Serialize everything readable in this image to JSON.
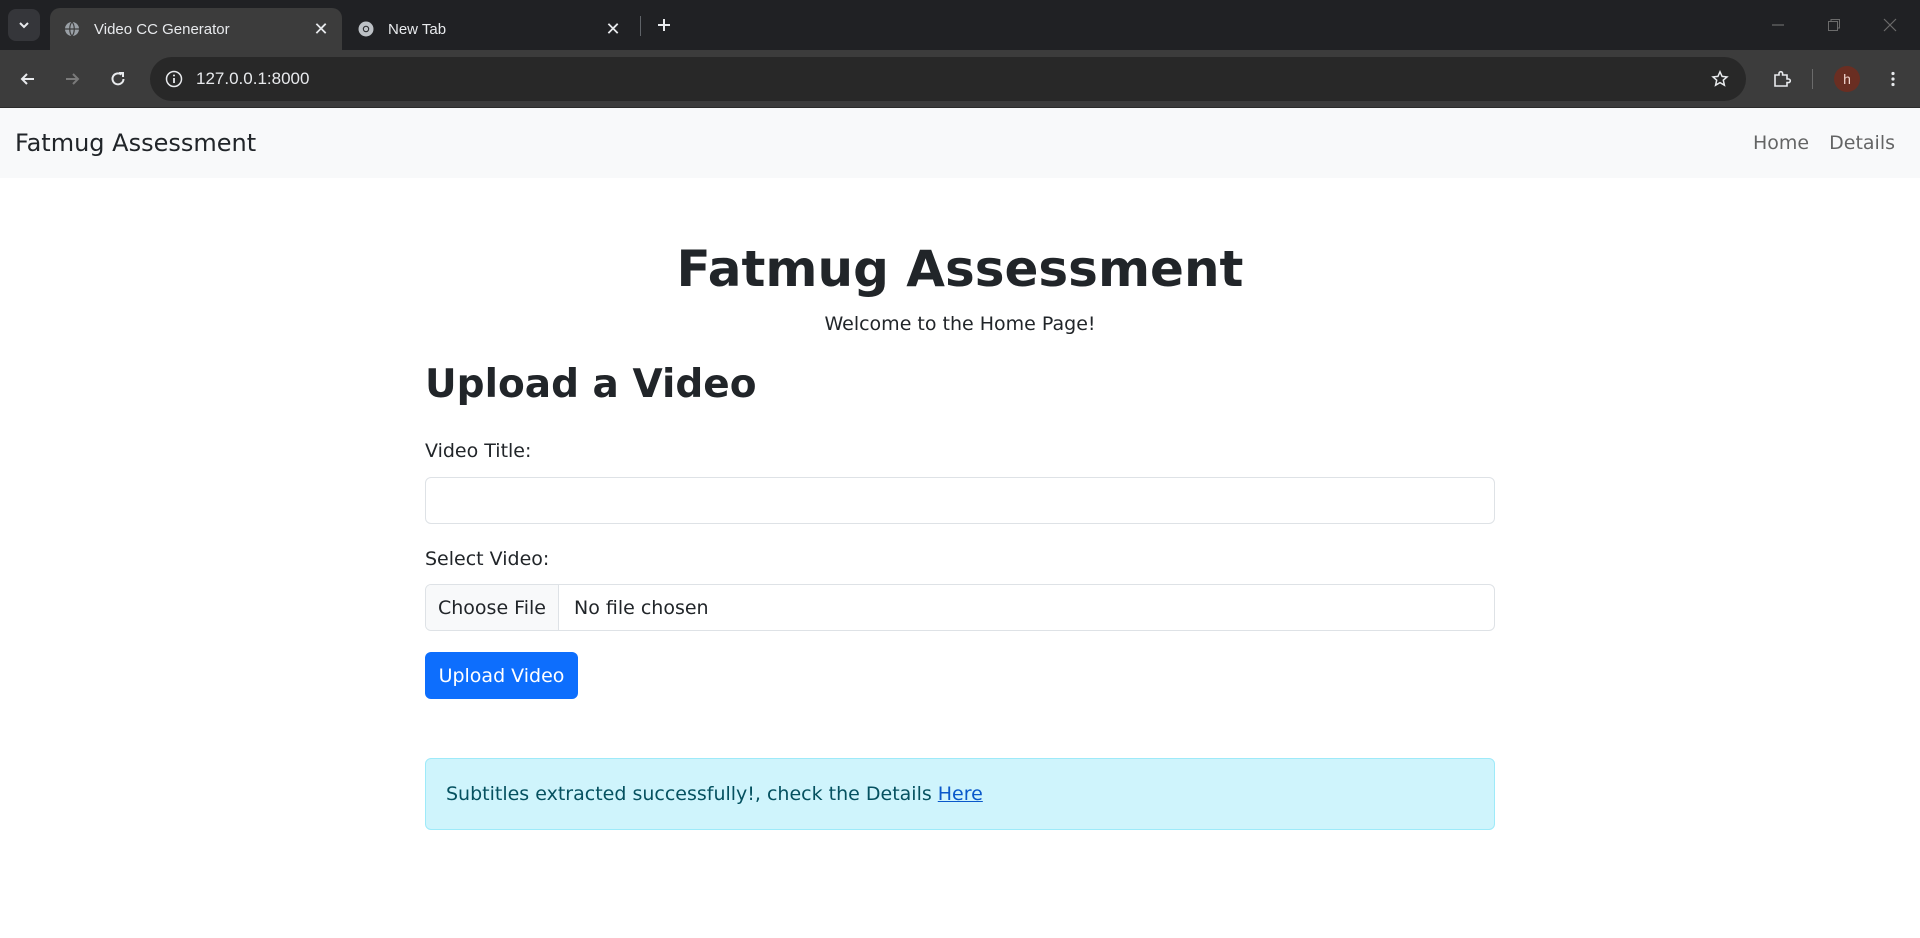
{
  "browser": {
    "tabs": [
      {
        "title": "Video CC Generator",
        "active": true
      },
      {
        "title": "New Tab",
        "active": false
      }
    ],
    "address": "127.0.0.1:8000",
    "profile_initial": "h"
  },
  "navbar": {
    "brand": "Fatmug Assessment",
    "links": [
      "Home",
      "Details"
    ]
  },
  "hero": {
    "title": "Fatmug Assessment",
    "subtitle": "Welcome to the Home Page!"
  },
  "form": {
    "heading": "Upload a Video",
    "title_label": "Video Title:",
    "title_value": "",
    "video_label": "Select Video:",
    "file_button": "Choose File",
    "file_status": "No file chosen",
    "submit": "Upload Video"
  },
  "alert": {
    "message": "Subtitles extracted successfully!, check the Details",
    "link": "Here"
  },
  "colors": {
    "primary": "#0d6efd",
    "alert_bg": "#cff4fc",
    "alert_text": "#055160",
    "navbar_bg": "#f8f9fa"
  }
}
